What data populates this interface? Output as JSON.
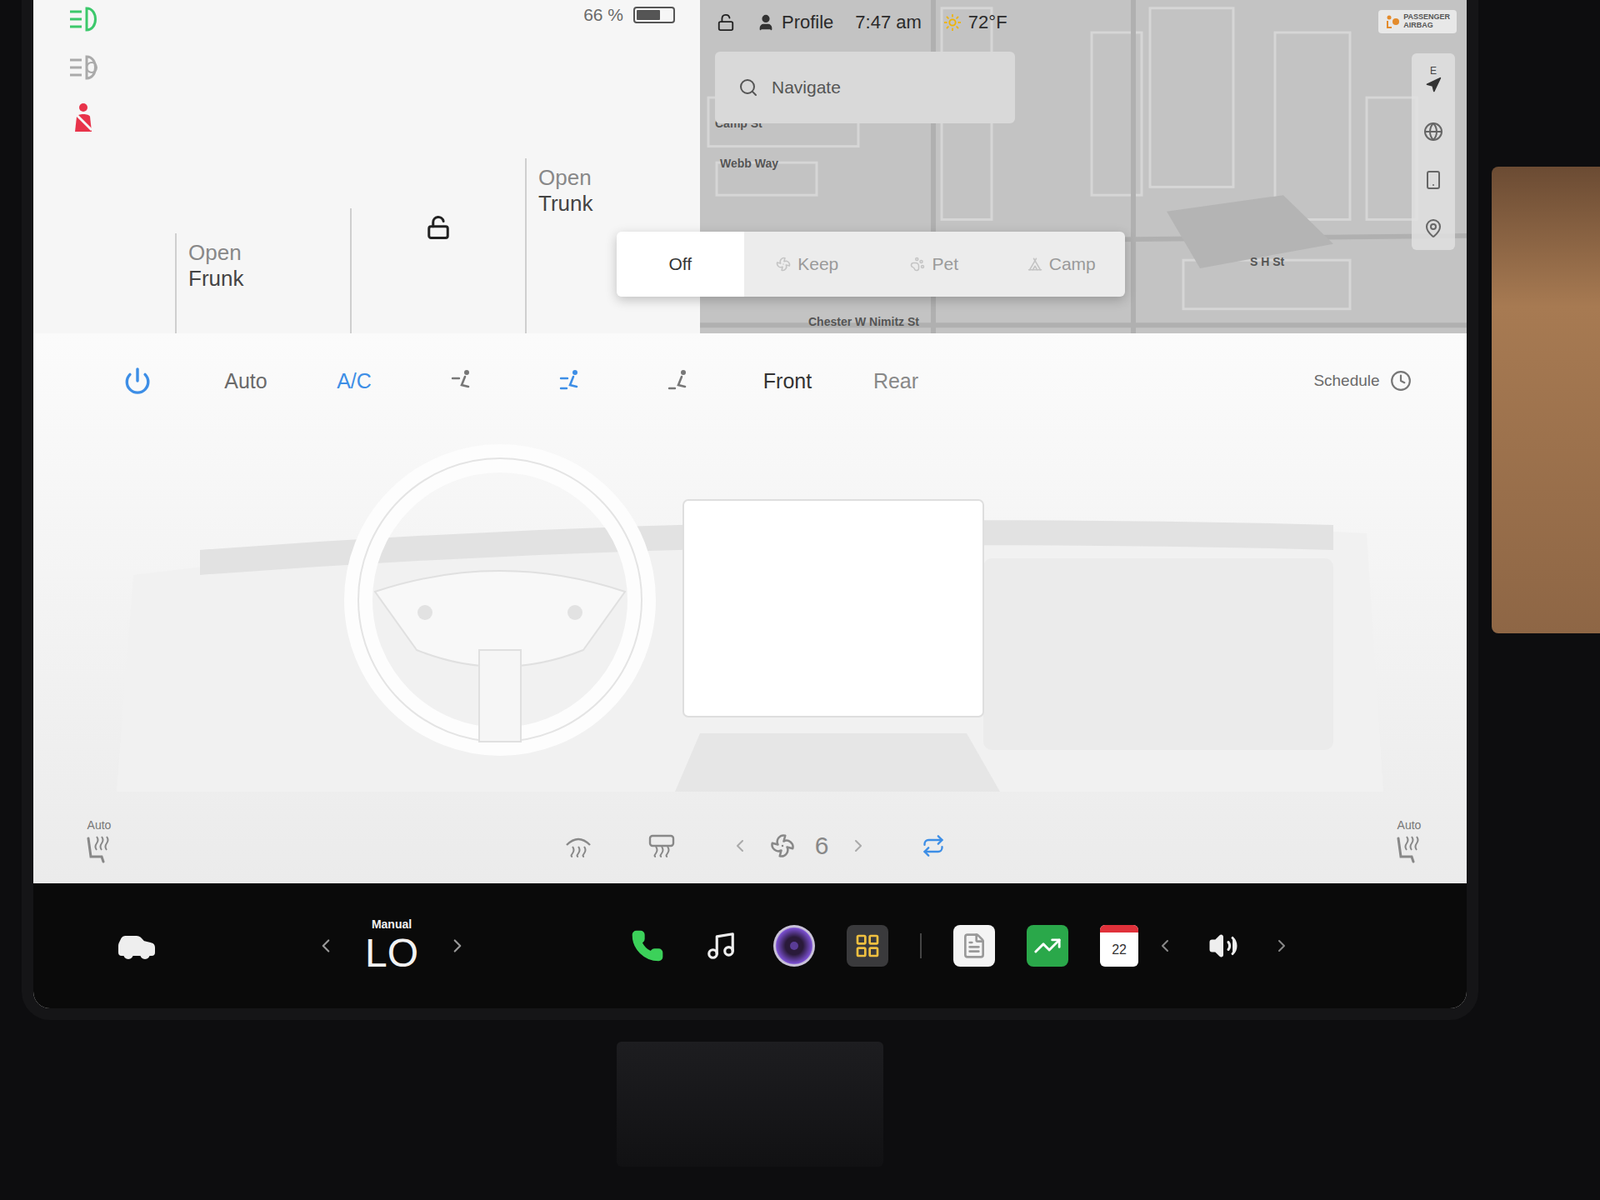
{
  "status": {
    "battery": "66 %",
    "battery_level": 0.66,
    "profile": "Profile",
    "time": "7:47 am",
    "outside_temperature": "72°F"
  },
  "indicators": {
    "headlights_on": true,
    "auto_high_beam": false,
    "seatbelt_warning": true
  },
  "car": {
    "locked": false,
    "frunk": [
      "Open",
      "Frunk"
    ],
    "trunk": [
      "Open",
      "Trunk"
    ]
  },
  "map": {
    "search_placeholder": "Navigate",
    "compass": "E",
    "airbag_badge": [
      "PASSENGER",
      "AIRBAG"
    ],
    "streets": [
      {
        "name": "Camp St"
      },
      {
        "name": "Webb Way"
      },
      {
        "name": "S H St"
      },
      {
        "name": "Chester W Nimitz St"
      }
    ]
  },
  "climate_modes": [
    {
      "label": "Off",
      "selected": true
    },
    {
      "label": "Keep",
      "selected": false
    },
    {
      "label": "Pet",
      "selected": false
    },
    {
      "label": "Camp",
      "selected": false
    }
  ],
  "climate": {
    "power_on": true,
    "auto": {
      "label": "Auto",
      "on": false
    },
    "ac": {
      "label": "A/C",
      "on": true
    },
    "airflow": [
      {
        "selected": false
      },
      {
        "selected": true
      },
      {
        "selected": false
      }
    ],
    "zones": [
      {
        "label": "Front",
        "selected": true
      },
      {
        "label": "Rear",
        "selected": false
      }
    ],
    "schedule": "Schedule",
    "fan_speed": "6",
    "recirculate": true,
    "defrost": [
      {
        "on": false
      },
      {
        "on": false
      }
    ],
    "seat_heaters": [
      {
        "label": "Auto"
      },
      {
        "label": "Auto"
      }
    ]
  },
  "bottom_bar": {
    "mode": "Manual",
    "temperature": "LO",
    "calendar_day": "22"
  }
}
